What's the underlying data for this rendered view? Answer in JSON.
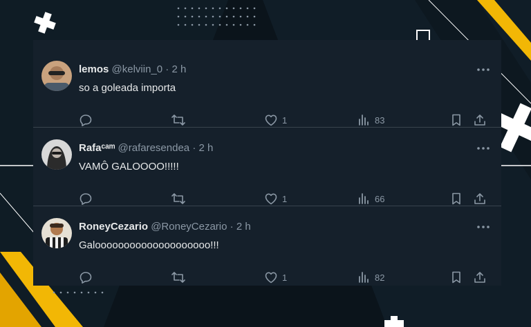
{
  "tweets": [
    {
      "name": "lemos",
      "handle": "@kelviin_0",
      "dot": "·",
      "time": "2 h",
      "text": "so a goleada importa",
      "reply_count": "",
      "retweet_count": "",
      "like_count": "1",
      "view_count": "83",
      "avatar_color": "#8a6a55"
    },
    {
      "name": "Rafaᶜᵃᵐ",
      "handle": "@rafaresendea",
      "dot": "·",
      "time": "2 h",
      "text": "VAMÔ GALOOOO!!!!!",
      "reply_count": "",
      "retweet_count": "",
      "like_count": "1",
      "view_count": "66",
      "avatar_color": "#3b3b3b"
    },
    {
      "name": "RoneyCezario",
      "handle": "@RoneyCezario",
      "dot": "·",
      "time": "2 h",
      "text": "Galoooooooooooooooooooo!!!",
      "reply_count": "",
      "retweet_count": "",
      "like_count": "1",
      "view_count": "82",
      "avatar_color": "#6a4a30"
    }
  ],
  "colors": {
    "card_bg": "#15202b",
    "divider": "#38444d",
    "text": "#e7e9ea",
    "muted": "#8b98a5",
    "accent_yellow": "#f2b705"
  }
}
